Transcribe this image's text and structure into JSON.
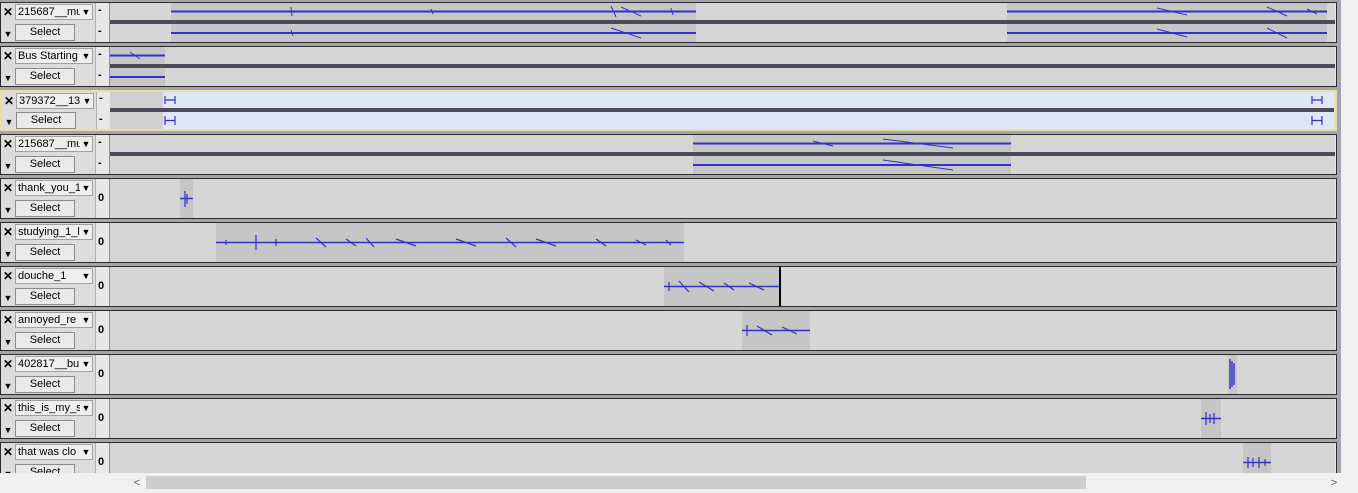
{
  "tracks": [
    {
      "name": "215687__mu",
      "select_label": "Select",
      "stereo": true,
      "minus": "-"
    },
    {
      "name": "Bus Starting",
      "select_label": "Select",
      "stereo": true,
      "minus": "-"
    },
    {
      "name": "379372__13",
      "select_label": "Select",
      "stereo": true,
      "minus": "-",
      "selected": true
    },
    {
      "name": "215687__mu",
      "select_label": "Select",
      "stereo": true,
      "minus": "-"
    },
    {
      "name": "thank_you_1",
      "select_label": "Select",
      "stereo": false,
      "level": "0"
    },
    {
      "name": "studying_1_l",
      "select_label": "Select",
      "stereo": false,
      "level": "0"
    },
    {
      "name": "douche_1",
      "select_label": "Select",
      "stereo": false,
      "level": "0"
    },
    {
      "name": "annoyed_re",
      "select_label": "Select",
      "stereo": false,
      "level": "0"
    },
    {
      "name": "402817__bu",
      "select_label": "Select",
      "stereo": false,
      "level": "0"
    },
    {
      "name": "this_is_my_s",
      "select_label": "Select",
      "stereo": false,
      "level": "0"
    },
    {
      "name": "that was clo",
      "select_label": "Select",
      "stereo": false,
      "level": "0"
    }
  ],
  "icons": {
    "close": "close-icon",
    "dropdown": "dropdown-arrow-icon",
    "track_menu": "track-menu-arrow-icon",
    "scroll_left": "scroll-left-icon",
    "scroll_right": "scroll-right-icon"
  },
  "glyphs": {
    "close": "✕",
    "dropdown": "▼",
    "scroll_left": "<",
    "scroll_right": ">"
  },
  "colors": {
    "waveform": "#3232c8",
    "selected_track_border": "#e8e0a0",
    "clip_selected": "#dfe6f5"
  }
}
